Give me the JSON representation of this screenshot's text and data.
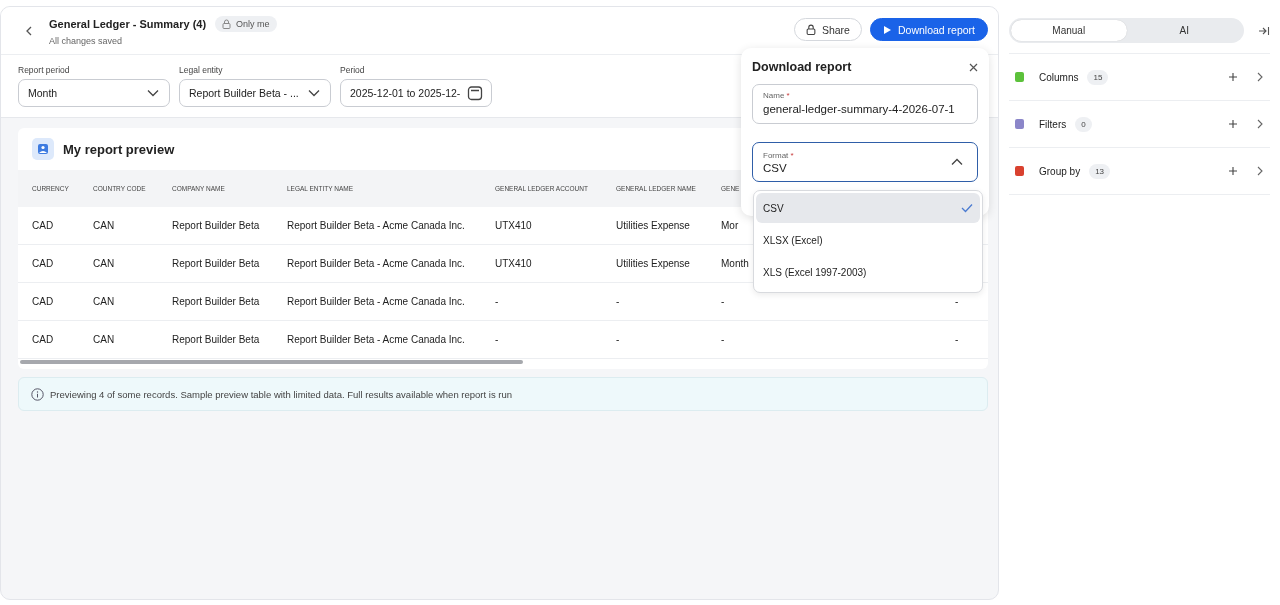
{
  "header": {
    "title": "General Ledger - Summary (4)",
    "visibility": "Only me",
    "status": "All changes saved"
  },
  "actions": [
    {
      "label": "Share",
      "kind": "secondary"
    },
    {
      "label": "Download report",
      "kind": "primary"
    }
  ],
  "filters": [
    {
      "label": "Report period",
      "value": "Month",
      "kind": "select"
    },
    {
      "label": "Legal entity",
      "value": "Report Builder Beta - ...",
      "kind": "select"
    },
    {
      "label": "Period",
      "value": "2025-12-01 to 2025-12-",
      "kind": "date"
    }
  ],
  "preview": {
    "title": "My report preview",
    "table": {
      "columns": [
        "CURRENCY",
        "COUNTRY CODE",
        "COMPANY NAME",
        "LEGAL ENTITY NAME",
        "GENERAL LEDGER ACCOUNT",
        "GENERAL LEDGER NAME",
        "GENE"
      ],
      "rows": [
        [
          "CAD",
          "CAN",
          "Report Builder Beta",
          "Report Builder Beta - Acme Canada Inc.",
          "UTX410",
          "Utilities Expense",
          "Mor"
        ],
        [
          "CAD",
          "CAN",
          "Report Builder Beta",
          "Report Builder Beta - Acme Canada Inc.",
          "UTX410",
          "Utilities Expense",
          "Month"
        ],
        [
          "CAD",
          "CAN",
          "Report Builder Beta",
          "Report Builder Beta - Acme Canada Inc.",
          "-",
          "-",
          "-",
          "-"
        ],
        [
          "CAD",
          "CAN",
          "Report Builder Beta",
          "Report Builder Beta - Acme Canada Inc.",
          "-",
          "-",
          "-",
          "-"
        ]
      ]
    }
  },
  "notice": "Previewing 4 of some records. Sample preview table with limited data. Full results available when report is run",
  "download_dialog": {
    "title": "Download report",
    "name_field": {
      "label": "Name",
      "required_mark": "*",
      "value": "general-ledger-summary-4-2026-07-1"
    },
    "format_field": {
      "label": "Format",
      "required_mark": "*",
      "value": "CSV",
      "expanded": true,
      "options": [
        {
          "label": "CSV",
          "selected": true
        },
        {
          "label": "XLSX (Excel)",
          "selected": false
        },
        {
          "label": "XLS (Excel 1997-2003)",
          "selected": false
        }
      ]
    }
  },
  "mode_switch": [
    {
      "label": "Manual",
      "selected": true
    },
    {
      "label": "AI",
      "selected": false
    }
  ],
  "sections": [
    {
      "label": "Columns",
      "count": "15",
      "color": "#5cc13b"
    },
    {
      "label": "Filters",
      "count": "0",
      "color": "#8b86c9"
    },
    {
      "label": "Group by",
      "count": "13",
      "color": "#d9412f"
    }
  ]
}
